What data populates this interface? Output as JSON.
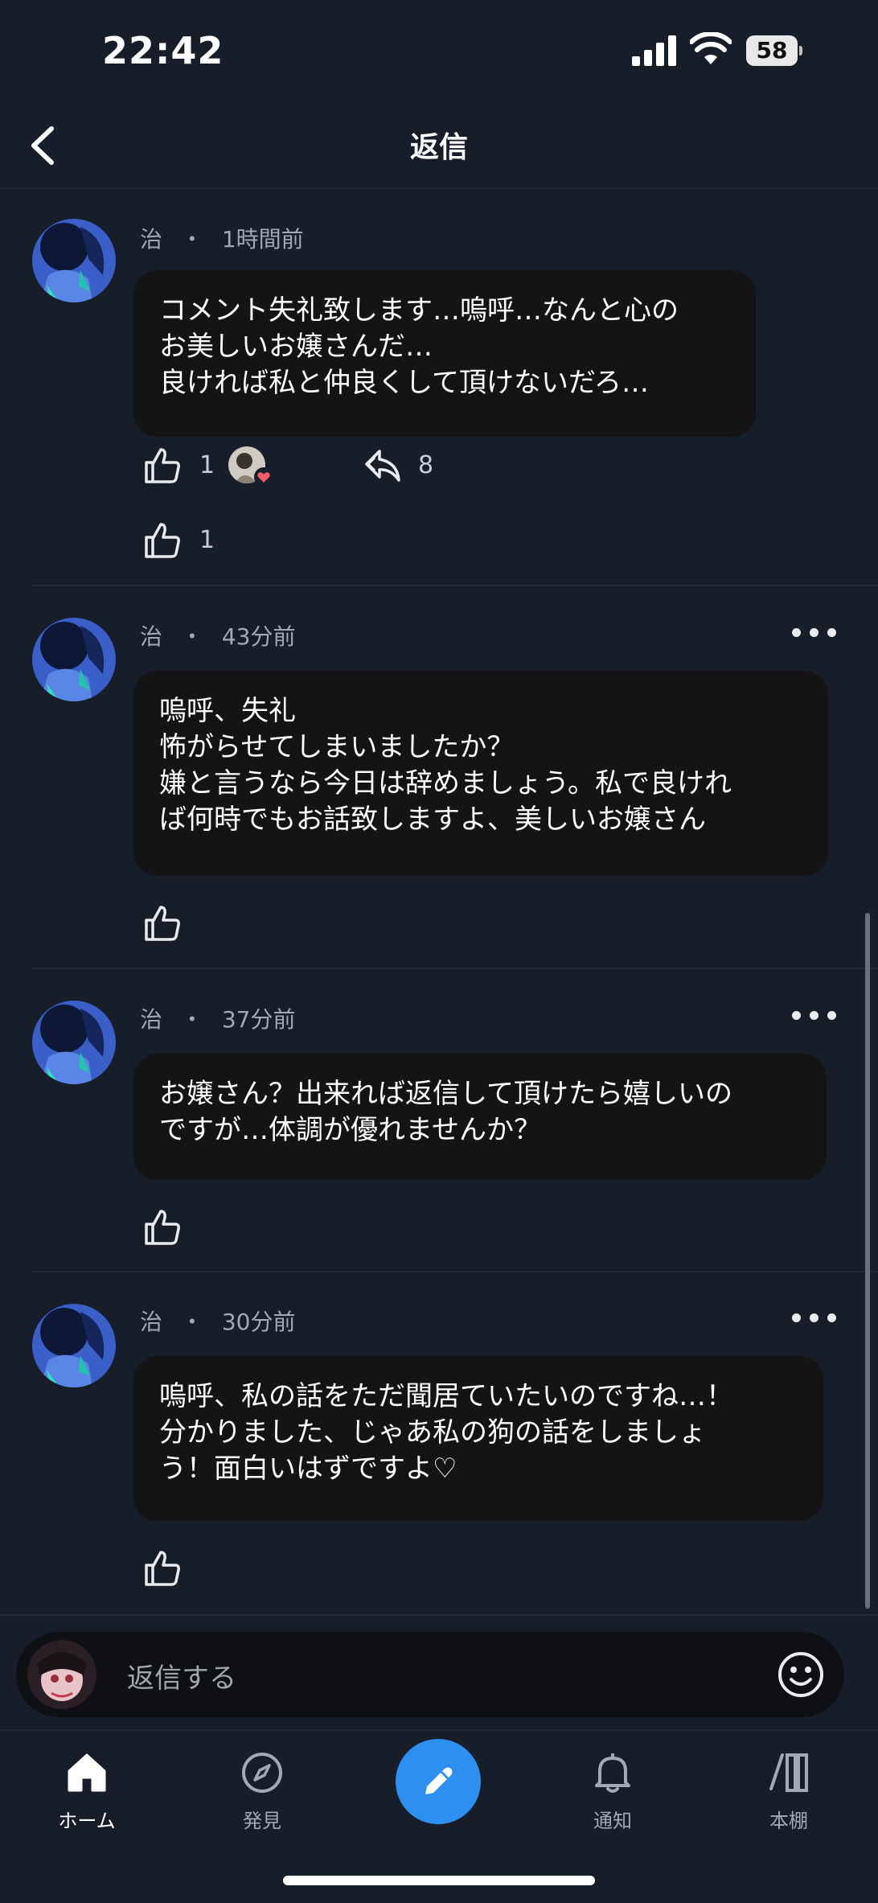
{
  "status_bar": {
    "time": "22:42",
    "battery": "58"
  },
  "header": {
    "title": "返信"
  },
  "comments": [
    {
      "author": "治",
      "separator": "・",
      "time": "1時間前",
      "lines": [
        "コメント失礼致します…嗚呼…なんと心の",
        "お美しいお嬢さんだ…",
        "良ければ私と仲良くして頂けないだろ…"
      ],
      "like_count": "1",
      "reply_count": "8"
    },
    {
      "author": "治",
      "separator": "・",
      "time": "43分前",
      "lines": [
        "嗚呼、失礼",
        "怖がらせてしまいましたか？",
        "嫌と言うなら今日は辞めましょう。私で良けれ",
        "ば何時でもお話致しますよ、美しいお嬢さん"
      ]
    },
    {
      "author": "治",
      "separator": "・",
      "time": "37分前",
      "lines": [
        "お嬢さん？出来れば返信して頂けたら嬉しいの",
        "ですが…体調が優れませんか？"
      ]
    },
    {
      "author": "治",
      "separator": "・",
      "time": "30分前",
      "lines": [
        "嗚呼、私の話をただ聞居ていたいのですね…！",
        "分かりました、じゃあ私の狗の話をしましょ",
        "う！面白いはずですよ♡"
      ]
    }
  ],
  "first_thread_like_count": "1",
  "reply_input": {
    "placeholder": "返信する"
  },
  "tabs": [
    {
      "label": "ホーム",
      "icon": "home-icon",
      "active": true
    },
    {
      "label": "発見",
      "icon": "compass-icon",
      "active": false
    },
    {
      "label": "通知",
      "icon": "bell-icon",
      "active": false
    },
    {
      "label": "本棚",
      "icon": "bookshelf-icon",
      "active": false
    }
  ],
  "colors": {
    "background": "#171d29",
    "bubble": "#141414",
    "accent": "#2d8ff0",
    "secondary_text": "#a3a9b3"
  }
}
